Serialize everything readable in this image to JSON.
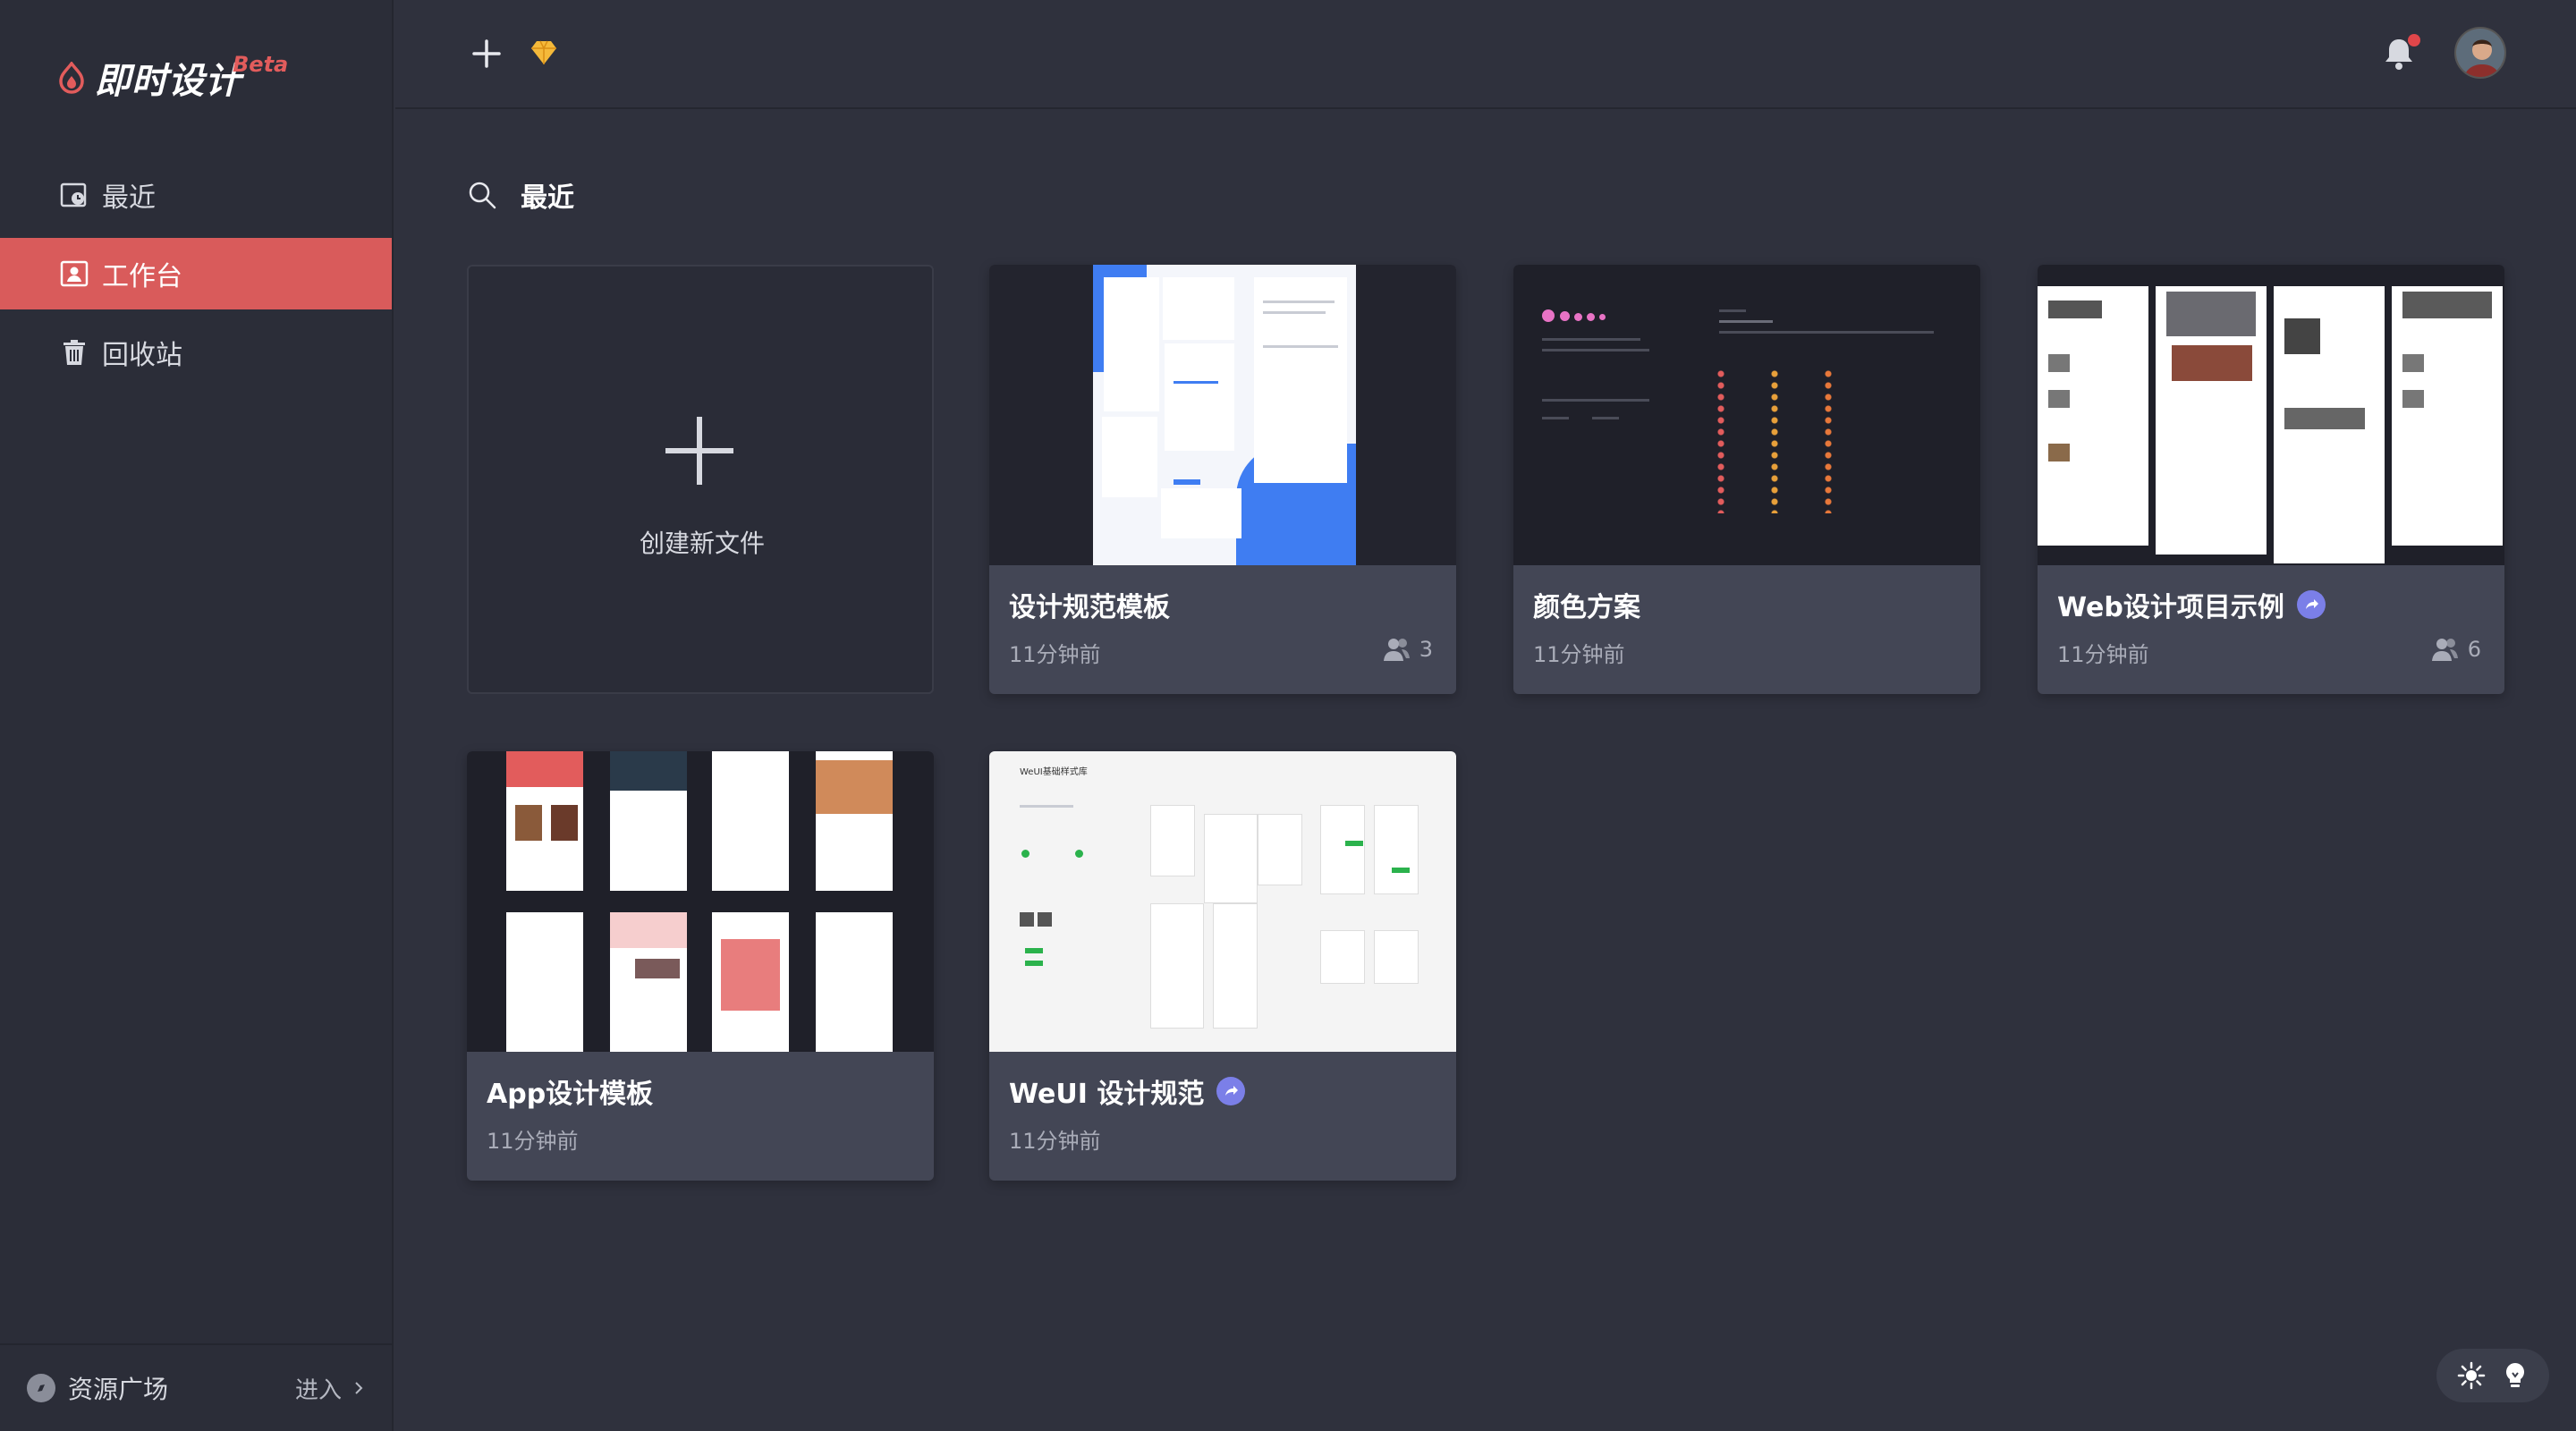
{
  "brand": {
    "name": "即时设计",
    "badge": "Beta",
    "accent": "#e25c5c"
  },
  "sidebar": {
    "items": [
      {
        "label": "最近",
        "icon": "clock-folder-icon",
        "active": false
      },
      {
        "label": "工作台",
        "icon": "workspace-user-icon",
        "active": true
      },
      {
        "label": "回收站",
        "icon": "trash-icon",
        "active": false
      }
    ],
    "footer": {
      "label": "资源广场",
      "action": "进入"
    }
  },
  "topbar": {
    "actions": [
      "plus-icon",
      "diamond-icon"
    ],
    "notifications": {
      "has_unread": true
    }
  },
  "main": {
    "section_title": "最近",
    "new_file_label": "创建新文件",
    "files": [
      {
        "title": "设计规范模板",
        "time": "11分钟前",
        "members": "3",
        "shared": false
      },
      {
        "title": "颜色方案",
        "time": "11分钟前",
        "members": "",
        "shared": false
      },
      {
        "title": "Web设计项目示例",
        "time": "11分钟前",
        "members": "6",
        "shared": true
      },
      {
        "title": "App设计模板",
        "time": "11分钟前",
        "members": "",
        "shared": false
      },
      {
        "title": "WeUI 设计规范",
        "time": "11分钟前",
        "members": "",
        "shared": true
      }
    ],
    "thumb_texts": {
      "weui_header": "WeUI基础样式库"
    }
  },
  "colors": {
    "background": "#2f313d",
    "sidebar": "#2b2d38",
    "card": "#434655",
    "active_nav": "#d95b5b",
    "share_badge": "#7b7fe8"
  }
}
